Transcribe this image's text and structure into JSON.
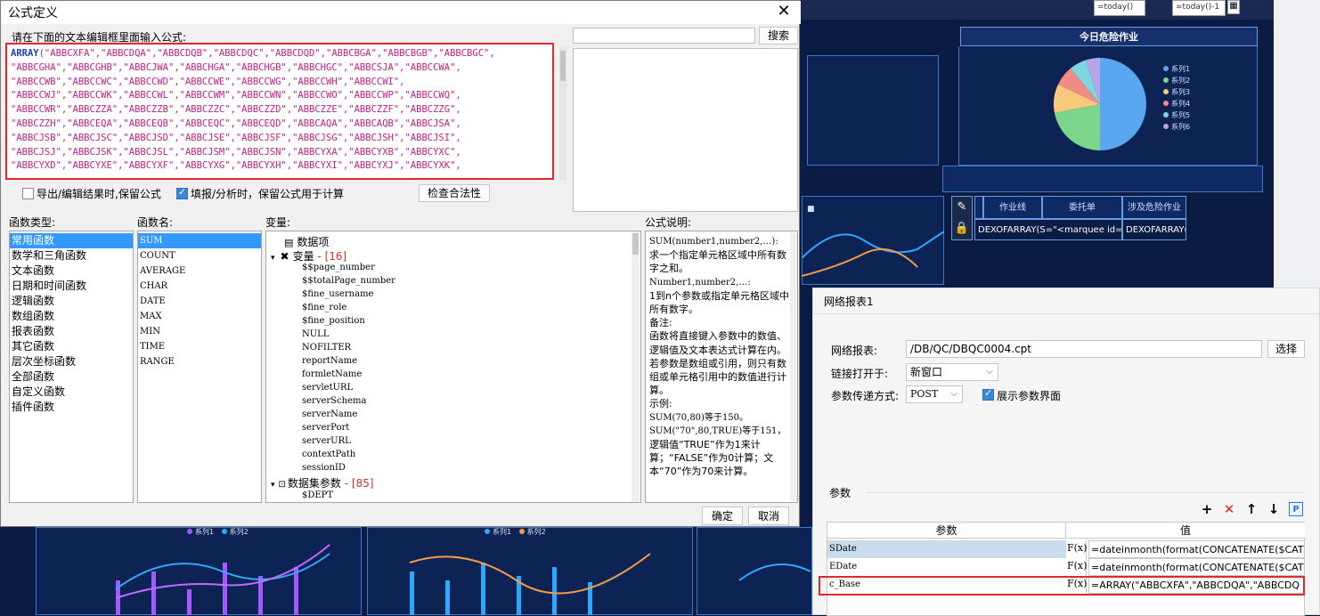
{
  "formula_dialog": {
    "title": "公式定义",
    "close_glyph": "✕",
    "instruction": "请在下面的文本编辑框里面输入公式:",
    "editor_lines": [
      [
        "ARRAY",
        "(\"ABBCXFA\",\"ABBCDQA\",\"ABBCDQB\",\"ABBCDQC\",\"ABBCDQD\",\"ABBCBGA\",\"ABBCBGB\",\"ABBCBGC\","
      ],
      [
        "",
        "\"ABBCGHA\",\"ABBCGHB\",\"ABBCJWA\",\"ABBCHGA\",\"ABBCHGB\",\"ABBCHGC\",\"ABBCSJA\",\"ABBCCWA\","
      ],
      [
        "",
        "\"ABBCCWB\",\"ABBCCWC\",\"ABBCCWD\",\"ABBCCWE\",\"ABBCCWG\",\"ABBCCWH\",\"ABBCCWI\","
      ],
      [
        "",
        "\"ABBCCWJ\",\"ABBCCWK\",\"ABBCCWL\",\"ABBCCWM\",\"ABBCCWN\",\"ABBCCWO\",\"ABBCCWP\",\"ABBCCWQ\","
      ],
      [
        "",
        "\"ABBCCWR\",\"ABBCZZA\",\"ABBCZZB\",\"ABBCZZC\",\"ABBCZZD\",\"ABBCZZE\",\"ABBCZZF\",\"ABBCZZG\","
      ],
      [
        "",
        "\"ABBCZZH\",\"ABBCEQA\",\"ABBCEQB\",\"ABBCEQC\",\"ABBCEQD\",\"ABBCAQA\",\"ABBCAQB\",\"ABBCJSA\","
      ],
      [
        "",
        "\"ABBCJSB\",\"ABBCJSC\",\"ABBCJSD\",\"ABBCJSE\",\"ABBCJSF\",\"ABBCJSG\",\"ABBCJSH\",\"ABBCJSI\","
      ],
      [
        "",
        "\"ABBCJSJ\",\"ABBCJSK\",\"ABBCJSL\",\"ABBCJSM\",\"ABBCJSN\",\"ABBCYXA\",\"ABBCYXB\",\"ABBCYXC\","
      ],
      [
        "",
        "\"ABBCYXD\",\"ABBCYXE\",\"ABBCYXF\",\"ABBCYXG\",\"ABBCYXH\",\"ABBCYXI\",\"ABBCYXJ\",\"ABBCYXK\","
      ]
    ],
    "search_button": "搜索",
    "search_value": "",
    "checkbox_export": {
      "label": "导出/编辑结果时,保留公式",
      "checked": false
    },
    "checkbox_fill": {
      "label": "填报/分析时，保留公式用于计算",
      "checked": true
    },
    "check_validity_button": "检查合法性",
    "function_types_label": "函数类型:",
    "function_types": [
      "常用函数",
      "数学和三角函数",
      "文本函数",
      "日期和时间函数",
      "逻辑函数",
      "数组函数",
      "报表函数",
      "其它函数",
      "层次坐标函数",
      "全部函数",
      "自定义函数",
      "插件函数"
    ],
    "function_names_label": "函数名:",
    "function_names": [
      "SUM",
      "COUNT",
      "AVERAGE",
      "CHAR",
      "DATE",
      "MAX",
      "MIN",
      "TIME",
      "RANGE"
    ],
    "variables_label": "变量:",
    "variables_root": "数据项",
    "variables_group": "变量",
    "variables_group_count": "- [16]",
    "variables": [
      "$$page_number",
      "$$totalPage_number",
      "$fine_username",
      "$fine_role",
      "$fine_position",
      "NULL",
      "NOFILTER",
      "reportName",
      "formletName",
      "servletURL",
      "serverSchema",
      "serverName",
      "serverPort",
      "serverURL",
      "contextPath",
      "sessionID"
    ],
    "dataset_params_group": "数据集参数",
    "dataset_params_count": "- [85]",
    "dataset_params": [
      "$DEPT"
    ],
    "description_label": "公式说明:",
    "description": [
      [
        "m",
        "SUM(number1,number2,…):"
      ],
      [
        "t",
        "求一个指定单元格区域中所有数字之和。"
      ],
      [
        "m",
        "Number1,number2,…:"
      ],
      [
        "t",
        "1到n个参数或指定单元格区域中所有数字。"
      ],
      [
        "t",
        "备注:"
      ],
      [
        "t",
        "函数将直接键入参数中的数值、逻辑值及文本表达式计算在内。若参数是数组或引用，则只有数组或单元格引用中的数值进行计算。"
      ],
      [
        "t",
        "示例:"
      ],
      [
        "m",
        "SUM(70,80)等于150。"
      ],
      [
        "m",
        "SUM(\"70\",80,TRUE)等于151，"
      ],
      [
        "t",
        "逻辑值“TRUE”作为1来计算；“FALSE”作为0计算；文本“70”作为70来计算。"
      ]
    ],
    "ok_button": "确定",
    "cancel_button": "取消"
  },
  "net_dialog": {
    "title": "网络报表1",
    "report_label": "网络报表:",
    "report_value": "/DB/QC/DBQC0004.cpt",
    "select_button": "选择",
    "open_in_label": "链接打开于:",
    "open_in_value": "新窗口",
    "param_method_label": "参数传递方式:",
    "param_method_value": "POST",
    "show_params_label": "展示参数界面",
    "show_params_checked": true,
    "params_section": "参数",
    "col_param": "参数",
    "col_value": "值",
    "fx_glyph": "F(x)",
    "rows": [
      {
        "name": "SDate",
        "value": "=dateinmonth(format(CONCATENATE($CAT"
      },
      {
        "name": "EDate",
        "value": "=dateinmonth(format(CONCATENATE($CAT"
      },
      {
        "name": "c_Base",
        "value": "=ARRAY(\"ABBCXFA\",\"ABBCDQA\",\"ABBCDQ"
      }
    ],
    "tool_icons": [
      "+",
      "✕",
      "↑",
      "↓",
      "P"
    ]
  },
  "dashboard": {
    "input_a": "=today()",
    "input_b": "=today()-1",
    "pie_title": "今日危险作业",
    "pie_legend": [
      "系列1",
      "系列2",
      "系列3",
      "系列4",
      "系列5",
      "系列6"
    ],
    "pie_colors": [
      "#5aa7f0",
      "#7ad68a",
      "#f8c97a",
      "#f08c86",
      "#7fd6e0",
      "#b6a6e8"
    ],
    "pie_values": [
      50,
      22,
      10,
      7,
      6,
      5
    ],
    "table_headers": [
      "作业线",
      "委托单",
      "涉及危险作业"
    ],
    "table_cells": [
      "DEXOFARRAY(S=\"<marquee id=",
      "DEXOFARRAY("
    ],
    "bottom_legend_a": [
      "系列1",
      "系列2"
    ],
    "bottom_legend_b": [
      "系列1",
      "系列2"
    ],
    "colors": {
      "accent": "#3b86d9",
      "highlight_border": "#e0282e"
    }
  }
}
